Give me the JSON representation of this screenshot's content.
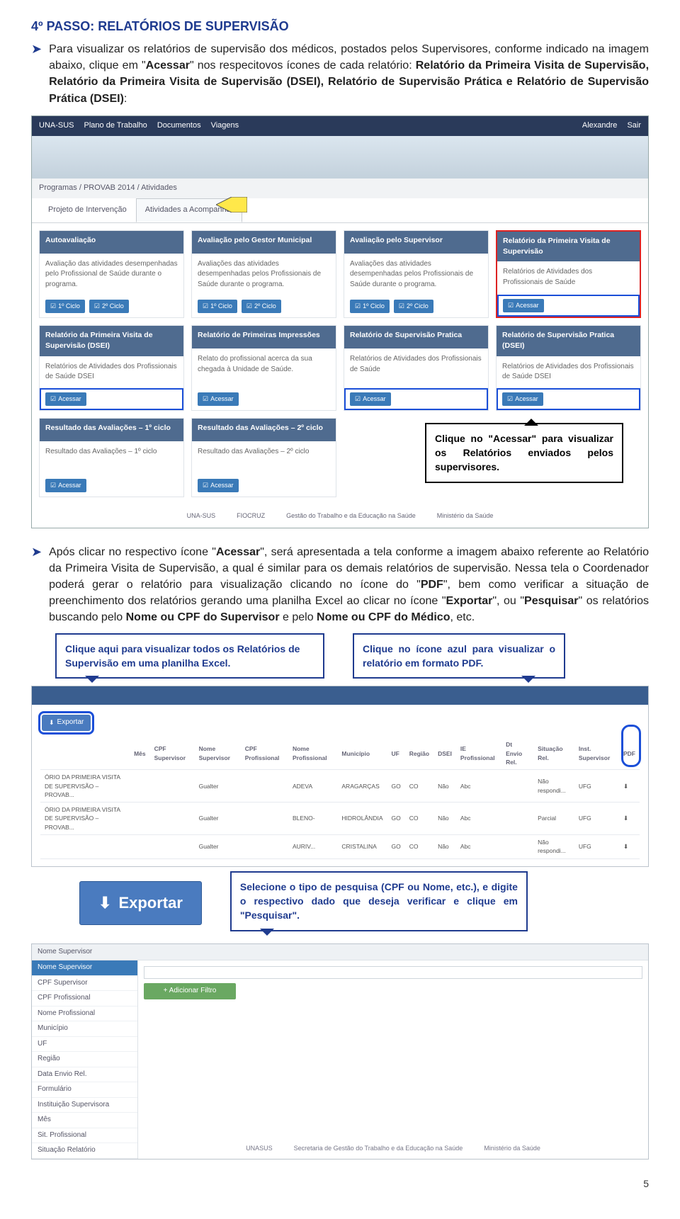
{
  "step_title": "4º PASSO: RELATÓRIOS DE SUPERVISÃO",
  "p1_a": "Para visualizar os relatórios de supervisão dos médicos, postados pelos Supervisores, conforme indicado na imagem abaixo, clique em \"",
  "p1_b": "Acessar",
  "p1_c": "\" nos respecitovos ícones de cada relatório: ",
  "p1_d": "Relatório da Primeira Visita de Supervisão, Relatório da Primeira Visita de Supervisão (DSEI), Relatório de Supervisão Prática e Relatório de Supervisão Prática (DSEI)",
  "p1_e": ":",
  "topbar": {
    "brand": "UNA-SUS",
    "items": [
      "Plano de Trabalho",
      "Documentos",
      "Viagens"
    ],
    "right": [
      "Alexandre",
      "Sair"
    ]
  },
  "crumbs": "Programas  /  PROVAB 2014  /  Atividades",
  "tabs": [
    "Projeto de Intervenção",
    "Atividades a Acompanhar"
  ],
  "cards_r1": [
    {
      "title": "Autoavaliação",
      "body": "Avaliação das atividades desempenhadas pelo Profissional de Saúde durante o programa.",
      "btns": [
        "1º Ciclo",
        "2º Ciclo"
      ]
    },
    {
      "title": "Avaliação pelo Gestor Municipal",
      "body": "Avaliações das atividades desempenhadas pelos Profissionais de Saúde durante o programa.",
      "btns": [
        "1º Ciclo",
        "2º Ciclo"
      ]
    },
    {
      "title": "Avaliação pelo Supervisor",
      "body": "Avaliações das atividades desempenhadas pelos Profissionais de Saúde durante o programa.",
      "btns": [
        "1º Ciclo",
        "2º Ciclo"
      ]
    },
    {
      "title": "Relatório da Primeira Visita de Supervisão",
      "body": "Relatórios de Atividades dos Profissionais de Saúde",
      "btns": [
        "Acessar"
      ],
      "red": true,
      "blue": true
    }
  ],
  "cards_r2": [
    {
      "title": "Relatório da Primeira Visita de Supervisão (DSEI)",
      "body": "Relatórios de Atividades dos Profissionais de Saúde DSEI",
      "btns": [
        "Acessar"
      ],
      "blue": true
    },
    {
      "title": "Relatório de Primeiras Impressões",
      "body": "Relato do profissional acerca da sua chegada à Unidade de Saúde.",
      "btns": [
        "Acessar"
      ]
    },
    {
      "title": "Relatório de Supervisão Pratica",
      "body": "Relatórios de Atividades dos Profissionais de Saúde",
      "btns": [
        "Acessar"
      ],
      "blue": true
    },
    {
      "title": "Relatório de Supervisão Pratica (DSEI)",
      "body": "Relatórios de Atividades dos Profissionais de Saúde DSEI",
      "btns": [
        "Acessar"
      ],
      "blue": true
    }
  ],
  "cards_r3": [
    {
      "title": "Resultado das Avaliações – 1º ciclo",
      "body": "Resultado das Avaliações – 1º ciclo",
      "btns": [
        "Acessar"
      ]
    },
    {
      "title": "Resultado das Avaliações – 2º ciclo",
      "body": "Resultado das Avaliações – 2º ciclo",
      "btns": [
        "Acessar"
      ]
    }
  ],
  "callout1_a": "Clique no \"",
  "callout1_b": "Acessar",
  "callout1_c": "\" para visualizar os Relatórios enviados pelos supervisores.",
  "footer_logos": [
    "UNA-SUS",
    "FIOCRUZ",
    "Gestão do Trabalho e da Educação na Saúde",
    "Ministério da Saúde"
  ],
  "p2_a": "Após clicar no respectivo ícone \"",
  "p2_b": "Acessar",
  "p2_c": "\", será apresentada a tela conforme a imagem abaixo referente ao Relatório da Primeira Visita de Supervisão, a qual é similar para os demais relatórios de supervisão. Nessa tela o Coordenador poderá gerar o relatório para visualização clicando no ícone do \"",
  "p2_d": "PDF",
  "p2_e": "\", bem como verificar a situação de preenchimento dos relatórios gerando uma planilha Excel ao clicar no ícone \"",
  "p2_f": "Exportar",
  "p2_g": "\", ou \"",
  "p2_h": "Pesquisar",
  "p2_i": "\" os relatórios buscando pelo ",
  "p2_j": "Nome ou CPF do Supervisor",
  "p2_k": " e pelo ",
  "p2_l": "Nome ou CPF do Médico",
  "p2_m": ", etc.",
  "callout2": "Clique aqui para visualizar todos os Relatórios de Supervisão em uma planilha Excel.",
  "callout3": "Clique no ícone  azul para visualizar o relatório em formato PDF.",
  "export_btn": "Exportar",
  "tbl_headers": [
    "",
    "Mês",
    "CPF Supervisor",
    "Nome Supervisor",
    "CPF Profissional",
    "Nome Profissional",
    "Município",
    "UF",
    "Região",
    "DSEI",
    "IE Profissional",
    "Dt Envio Rel.",
    "Situação Rel.",
    "Inst. Supervisor",
    "PDF"
  ],
  "tbl_rows": [
    [
      "ÓRIO DA PRIMEIRA VISITA DE SUPERVISÃO – PROVAB...",
      "",
      "",
      "Gualter",
      "",
      "ADEVA",
      "ARAGARÇAS",
      "GO",
      "CO",
      "Não",
      "Abc",
      "",
      "Não respondi...",
      "UFG",
      "⬇"
    ],
    [
      "ÓRIO DA PRIMEIRA VISITA DE SUPERVISÃO – PROVAB...",
      "",
      "",
      "Gualter",
      "",
      "BLENO-",
      "HIDROLÂNDIA",
      "GO",
      "CO",
      "Não",
      "Abc",
      "",
      "Parcial",
      "UFG",
      "⬇"
    ],
    [
      "",
      "",
      "",
      "Gualter",
      "",
      "AURIV...",
      "CRISTALINA",
      "GO",
      "CO",
      "Não",
      "Abc",
      "",
      "Não respondi...",
      "UFG",
      "⬇"
    ]
  ],
  "big_export": "Exportar",
  "callout4": "Selecione o tipo de pesquisa (CPF ou Nome, etc.), e digite o respectivo dado que deseja verificar e clique em \"Pesquisar\".",
  "filter_label": "Nome Supervisor",
  "filter_list": [
    "Nome Supervisor",
    "CPF Supervisor",
    "CPF Profissional",
    "Nome Profissional",
    "Município",
    "UF",
    "Região",
    "Data Envio Rel.",
    "Formulário",
    "Instituição Supervisora",
    "Mês",
    "Sit. Profissional",
    "Situação Relatório"
  ],
  "add_filter": "+ Adicionar Filtro",
  "filter_footer": [
    "UNASUS",
    "Secretaria de Gestão do Trabalho e da Educação na Saúde",
    "Ministério da Saúde"
  ],
  "page_num": "5"
}
